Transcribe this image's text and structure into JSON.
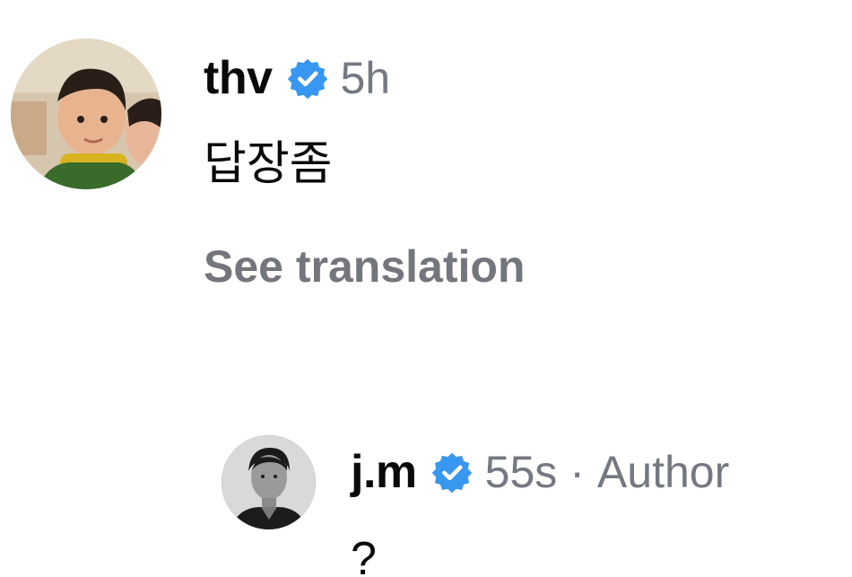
{
  "comments": [
    {
      "username": "thv",
      "verified_icon": "verified-badge-icon",
      "timestamp": "5h",
      "text": "답장좀",
      "see_translation": "See translation"
    },
    {
      "username": "j.m",
      "verified_icon": "verified-badge-icon",
      "timestamp": "55s",
      "separator": "·",
      "author_tag": "Author",
      "text": "?"
    }
  ],
  "colors": {
    "text_primary": "#0a0a0a",
    "text_secondary": "#747880",
    "verified_blue": "#3897f0",
    "background": "#ffffff"
  }
}
